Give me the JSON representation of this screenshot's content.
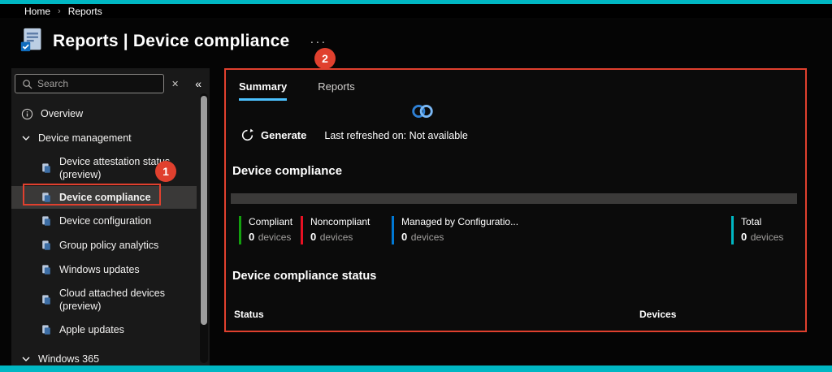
{
  "chrome": {
    "accent_color": "#00b7c3"
  },
  "topbar": {
    "home": "Home",
    "separator": "›",
    "current": "Reports"
  },
  "header": {
    "title": "Reports | Device compliance",
    "more_label": "···"
  },
  "sidebar": {
    "search_placeholder": "Search",
    "clear_label": "✕",
    "collapse_label": "«",
    "items": [
      {
        "label": "Overview"
      },
      {
        "label": "Device management"
      },
      {
        "label": "Device attestation status (preview)"
      },
      {
        "label": "Device compliance"
      },
      {
        "label": "Device configuration"
      },
      {
        "label": "Group policy analytics"
      },
      {
        "label": "Windows updates"
      },
      {
        "label": "Cloud attached devices (preview)"
      },
      {
        "label": "Apple updates"
      },
      {
        "label": "Windows 365"
      }
    ]
  },
  "main": {
    "tabs": [
      {
        "label": "Summary"
      },
      {
        "label": "Reports"
      }
    ],
    "tab_accent_color": "#4cc2ff",
    "generate_label": "Generate",
    "last_refreshed": "Last refreshed on: Not available",
    "compliance_title": "Device compliance",
    "stats": [
      {
        "label": "Compliant",
        "value": "0",
        "unit": "devices",
        "color": "#13a10e"
      },
      {
        "label": "Noncompliant",
        "value": "0",
        "unit": "devices",
        "color": "#e81123"
      },
      {
        "label": "Managed by Configuratio...",
        "value": "0",
        "unit": "devices",
        "color": "#0078d4"
      },
      {
        "label": "Total",
        "value": "0",
        "unit": "devices",
        "color": "#00b7c3"
      }
    ],
    "status_title": "Device compliance status",
    "table_headers": {
      "status": "Status",
      "devices": "Devices"
    }
  },
  "annotations": {
    "color": "#e0402e",
    "step1": "1",
    "step2": "2"
  }
}
